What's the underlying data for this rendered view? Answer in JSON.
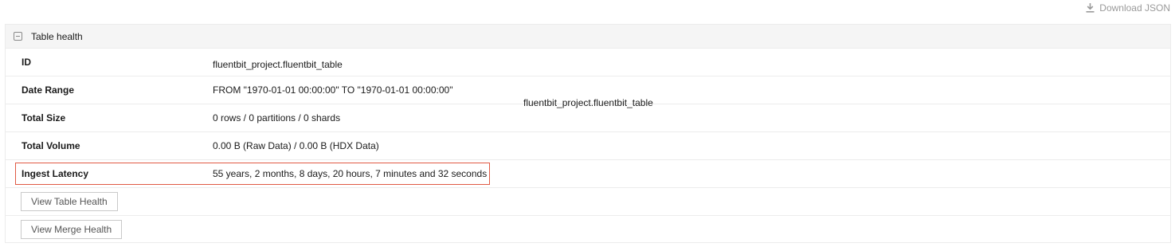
{
  "toolbar": {
    "download_label": "Download JSON",
    "download_icon": "download-icon"
  },
  "panel": {
    "title": "Table health",
    "collapse_icon": "collapse-minus-icon",
    "rows": [
      {
        "label": "ID",
        "value": "fluentbit_project.fluentbit_table"
      },
      {
        "label": "Date Range",
        "value": "FROM \"1970-01-01 00:00:00\" TO \"1970-01-01 00:00:00\""
      },
      {
        "label": "Total Size",
        "value": "0 rows / 0 partitions / 0 shards"
      },
      {
        "label": "Total Volume",
        "value": "0.00 B (Raw Data) / 0.00 B (HDX Data)"
      },
      {
        "label": "Ingest Latency",
        "value": "55 years, 2 months, 8 days, 20 hours, 7 minutes and 32 seconds"
      }
    ],
    "buttons": {
      "view_table_health": "View Table Health",
      "view_merge_health": "View Merge Health"
    }
  },
  "floating_text": "fluentbit_project.fluentbit_table",
  "colors": {
    "highlight": "#e05a44",
    "header_bg": "#f5f5f5",
    "muted_text": "#9a9a9a"
  }
}
